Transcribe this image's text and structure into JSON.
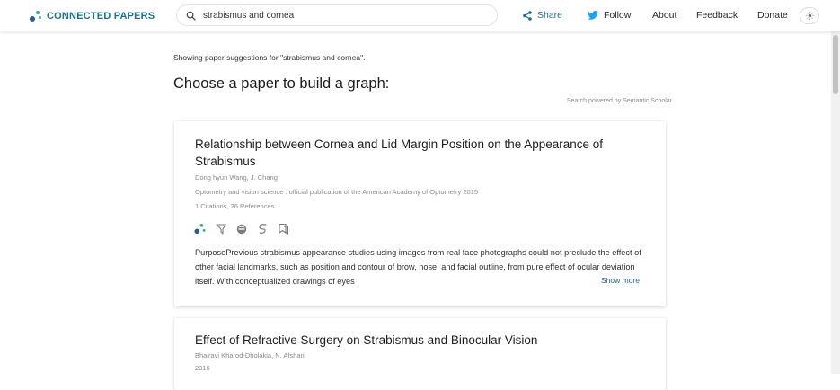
{
  "header": {
    "logo_text": "CONNECTED PAPERS",
    "search_value": "strabismus and cornea",
    "nav": {
      "share": "Share",
      "follow": "Follow",
      "about": "About",
      "feedback": "Feedback",
      "donate": "Donate"
    }
  },
  "main": {
    "showing_text": "Showing paper suggestions for \"strabismus and cornea\".",
    "heading": "Choose a paper to build a graph:",
    "powered_by": "Search powered by Semantic Scholar"
  },
  "results": [
    {
      "title": "Relationship between Cornea and Lid Margin Position on the Appearance of Strabismus",
      "authors": "Dong hyun Wang, J. Chang",
      "venue": "Optometry and vision science : official publication of the American Academy of Optometry 2015",
      "stats": "1 Citations, 26 References",
      "abstract": "PurposePrevious strabismus appearance studies using images from real face photographs could not preclude the effect of other facial landmarks, such as position and contour of brow, nose, and facial outline, from pure effect of ocular deviation itself. With conceptualized drawings of eyes",
      "show_more": "Show more"
    },
    {
      "title": "Effect of Refractive Surgery on Strabismus and Binocular Vision",
      "authors": "Bhairavi Kharod-Dholakia, N. Afshari",
      "venue": "2016"
    }
  ],
  "colors": {
    "brand_teal": "#1f7185",
    "twitter_blue": "#1da1f2",
    "logo_dot_green": "#3fb07f",
    "logo_dot_blue": "#2b5e8c"
  },
  "icons": [
    "graph-icon",
    "pdf-icon",
    "semantic-scholar-icon",
    "google-scholar-icon",
    "bookmark-icon"
  ]
}
